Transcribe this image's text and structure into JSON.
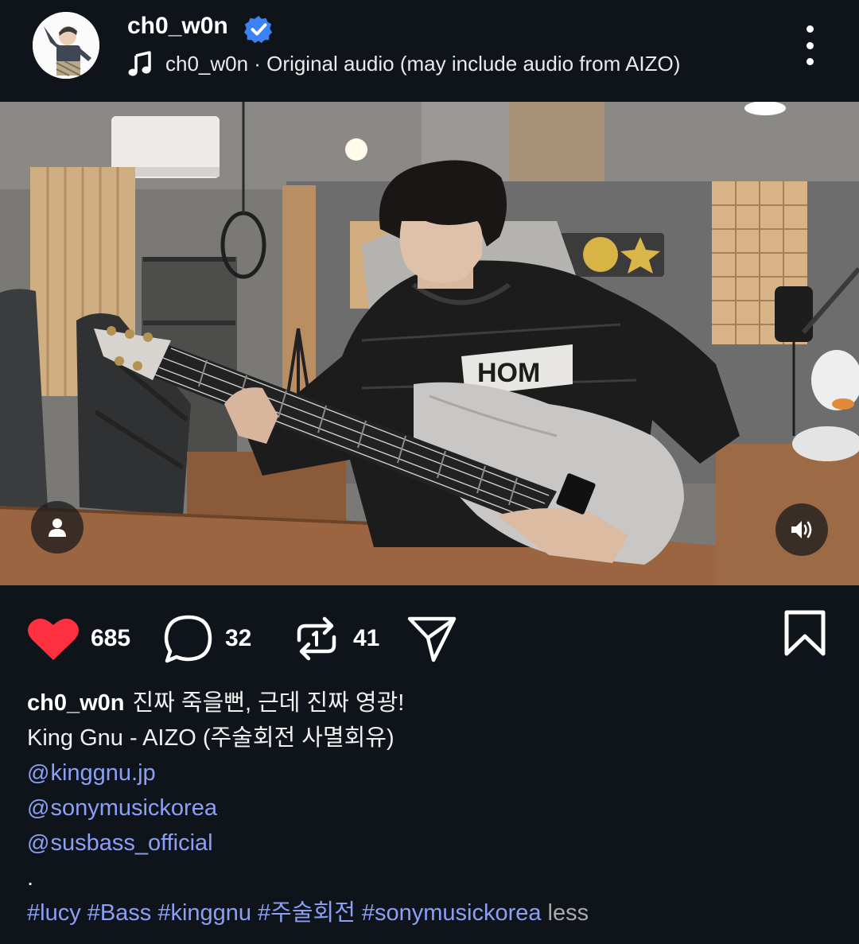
{
  "header": {
    "username": "ch0_w0n",
    "verified": true,
    "audio_text": "ch0_w0n · Original audio (may include audio from AIZO)"
  },
  "icons": {
    "verified": "verified-badge-icon",
    "audio": "music-note-icon",
    "more": "more-vertical-icon",
    "tag": "person-tag-icon",
    "volume": "volume-icon",
    "like": "heart-icon",
    "comment": "comment-icon",
    "repost": "repost-icon",
    "share": "send-icon",
    "save": "bookmark-icon"
  },
  "video": {
    "scene_text": "HOM"
  },
  "actions": {
    "likes": "685",
    "comments": "32",
    "reposts": "41"
  },
  "caption": {
    "username": "ch0_w0n",
    "text": "진짜 죽을뻔, 근데 진짜 영광!",
    "line2": "King Gnu - AIZO (주술회전 사멸회유)",
    "mentions": [
      "kinggnu.jp",
      "sonymusickorea",
      "susbass_official"
    ],
    "separator": ".",
    "hashtags": [
      "#lucy",
      "#Bass",
      "#kinggnu",
      "#주술회전",
      "#sonymusickorea"
    ],
    "less": "less"
  },
  "colors": {
    "background": "#0f141b",
    "like_red": "#ff3040",
    "link_blue": "#8ba0f5",
    "verified_blue": "#3b82f6"
  }
}
